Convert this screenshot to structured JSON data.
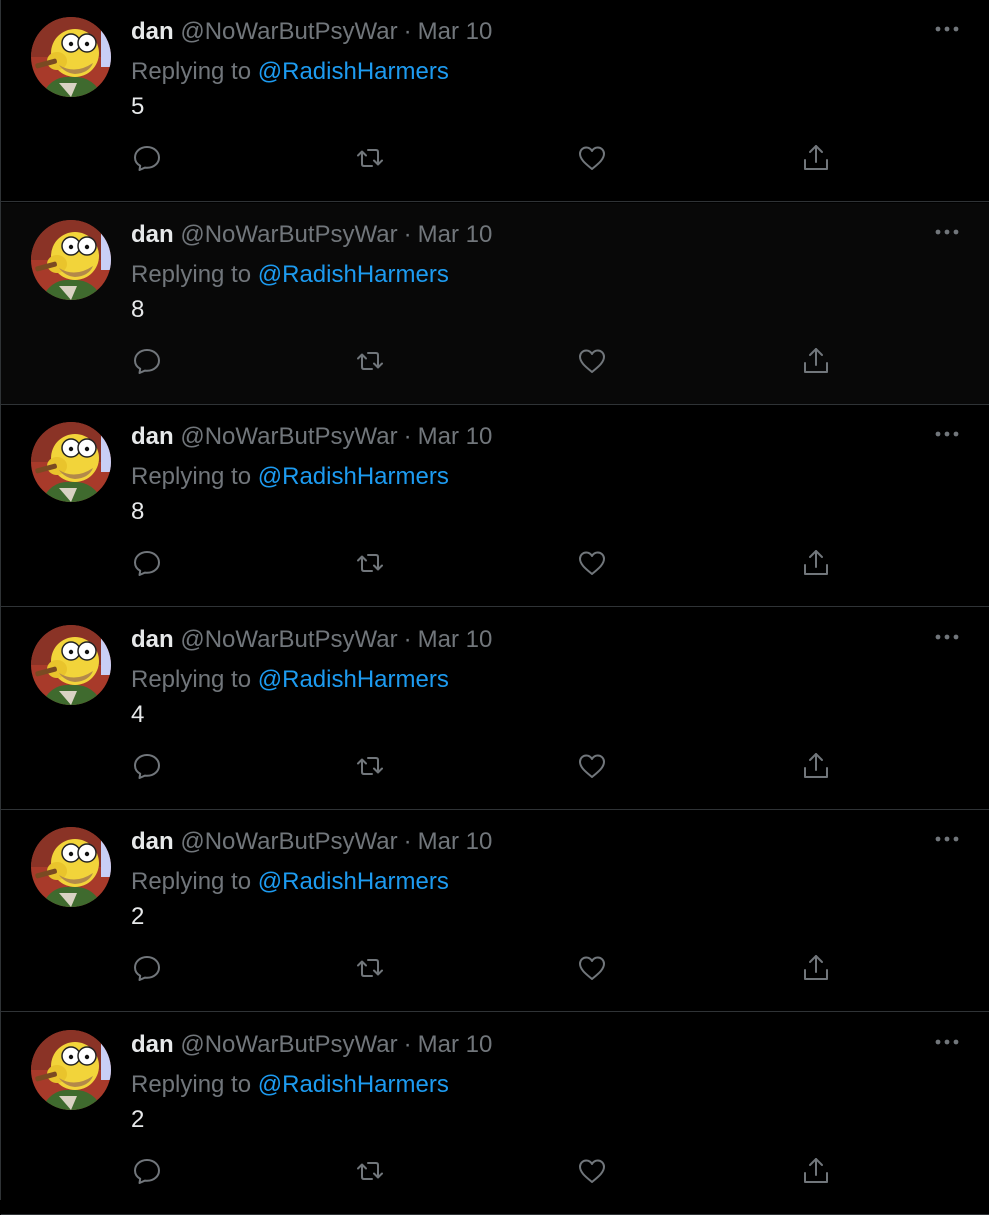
{
  "tweets": [
    {
      "name": "dan",
      "handle": "@NoWarButPsyWar",
      "separator": "·",
      "date": "Mar 10",
      "replying_prefix": "Replying to",
      "replying_to": "@RadishHarmers",
      "text": "5"
    },
    {
      "name": "dan",
      "handle": "@NoWarButPsyWar",
      "separator": "·",
      "date": "Mar 10",
      "replying_prefix": "Replying to",
      "replying_to": "@RadishHarmers",
      "text": "8"
    },
    {
      "name": "dan",
      "handle": "@NoWarButPsyWar",
      "separator": "·",
      "date": "Mar 10",
      "replying_prefix": "Replying to",
      "replying_to": "@RadishHarmers",
      "text": "8"
    },
    {
      "name": "dan",
      "handle": "@NoWarButPsyWar",
      "separator": "·",
      "date": "Mar 10",
      "replying_prefix": "Replying to",
      "replying_to": "@RadishHarmers",
      "text": "4"
    },
    {
      "name": "dan",
      "handle": "@NoWarButPsyWar",
      "separator": "·",
      "date": "Mar 10",
      "replying_prefix": "Replying to",
      "replying_to": "@RadishHarmers",
      "text": "2"
    },
    {
      "name": "dan",
      "handle": "@NoWarButPsyWar",
      "separator": "·",
      "date": "Mar 10",
      "replying_prefix": "Replying to",
      "replying_to": "@RadishHarmers",
      "text": "2"
    }
  ],
  "icons": {
    "more": "more-horizontal-icon",
    "reply": "reply-bubble-icon",
    "retweet": "retweet-icon",
    "like": "heart-icon",
    "share": "share-upload-icon"
  },
  "colors": {
    "background": "#000000",
    "hover_background": "#080808",
    "primary_text": "#e7e9ea",
    "secondary_text": "#71767b",
    "link": "#1d9bf0",
    "divider": "#2f3336"
  }
}
